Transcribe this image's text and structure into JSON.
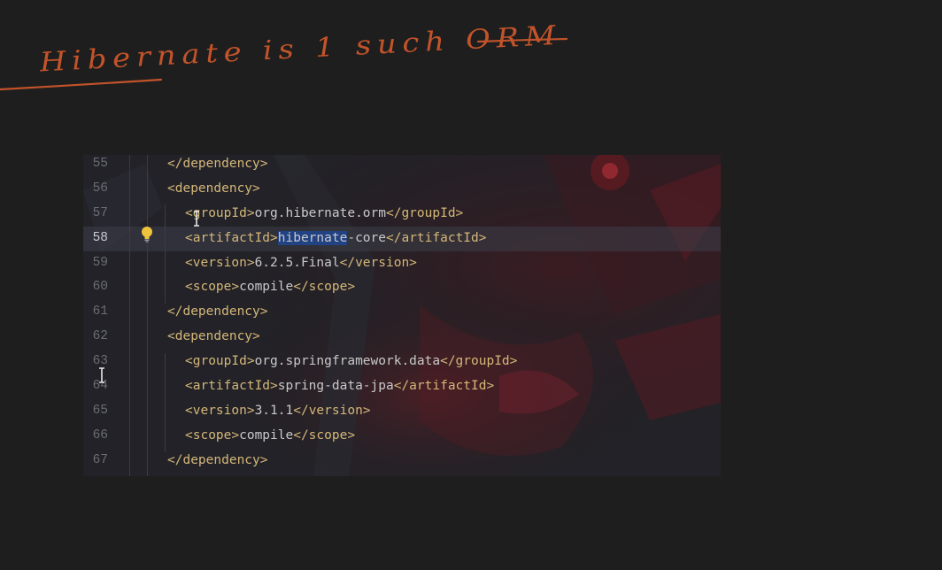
{
  "annotation": {
    "text": "Hibernate is 1 such ORM",
    "color": "#c2532a"
  },
  "editor": {
    "current_line": 58,
    "lines": [
      {
        "n": "55",
        "indent": 1,
        "tokens": [
          {
            "t": "tag",
            "v": "</dependency>"
          }
        ]
      },
      {
        "n": "56",
        "indent": 1,
        "tokens": [
          {
            "t": "tag",
            "v": "<dependency>"
          }
        ]
      },
      {
        "n": "57",
        "indent": 2,
        "tokens": [
          {
            "t": "tag",
            "v": "<groupId>"
          },
          {
            "t": "txt",
            "v": "org.hibernate.orm"
          },
          {
            "t": "tag",
            "v": "</groupId>"
          }
        ]
      },
      {
        "n": "58",
        "indent": 2,
        "tokens": [
          {
            "t": "tag",
            "v": "<artifactId>"
          },
          {
            "t": "sel",
            "v": "hibernate"
          },
          {
            "t": "txt",
            "v": "-core"
          },
          {
            "t": "tag",
            "v": "</artifactId>"
          }
        ]
      },
      {
        "n": "59",
        "indent": 2,
        "tokens": [
          {
            "t": "tag",
            "v": "<version>"
          },
          {
            "t": "txt",
            "v": "6.2.5.Final"
          },
          {
            "t": "tag",
            "v": "</version>"
          }
        ]
      },
      {
        "n": "60",
        "indent": 2,
        "tokens": [
          {
            "t": "tag",
            "v": "<scope>"
          },
          {
            "t": "txt",
            "v": "compile"
          },
          {
            "t": "tag",
            "v": "</scope>"
          }
        ]
      },
      {
        "n": "61",
        "indent": 1,
        "tokens": [
          {
            "t": "tag",
            "v": "</dependency>"
          }
        ]
      },
      {
        "n": "62",
        "indent": 1,
        "tokens": [
          {
            "t": "tag",
            "v": "<dependency>"
          }
        ]
      },
      {
        "n": "63",
        "indent": 2,
        "tokens": [
          {
            "t": "tag",
            "v": "<groupId>"
          },
          {
            "t": "txt",
            "v": "org.springframework.data"
          },
          {
            "t": "tag",
            "v": "</groupId>"
          }
        ]
      },
      {
        "n": "64",
        "indent": 2,
        "tokens": [
          {
            "t": "tag",
            "v": "<artifactId>"
          },
          {
            "t": "txt",
            "v": "spring-data-jpa"
          },
          {
            "t": "tag",
            "v": "</artifactId>"
          }
        ]
      },
      {
        "n": "65",
        "indent": 2,
        "tokens": [
          {
            "t": "tag",
            "v": "<version>"
          },
          {
            "t": "txt",
            "v": "3.1.1"
          },
          {
            "t": "tag",
            "v": "</version>"
          }
        ]
      },
      {
        "n": "66",
        "indent": 2,
        "tokens": [
          {
            "t": "tag",
            "v": "<scope>"
          },
          {
            "t": "txt",
            "v": "compile"
          },
          {
            "t": "tag",
            "v": "</scope>"
          }
        ]
      },
      {
        "n": "67",
        "indent": 1,
        "tokens": [
          {
            "t": "tag",
            "v": "</dependency>"
          }
        ]
      }
    ]
  },
  "colors": {
    "tag": "#d5b778",
    "text": "#c9c9c9",
    "selection": "#214283",
    "background": "#1e1e1e",
    "annotation_ink": "#c2532a",
    "intention_bulb": "#f0c33c"
  },
  "icons": [
    "intention-bulb-icon",
    "text-cursor-icon"
  ]
}
